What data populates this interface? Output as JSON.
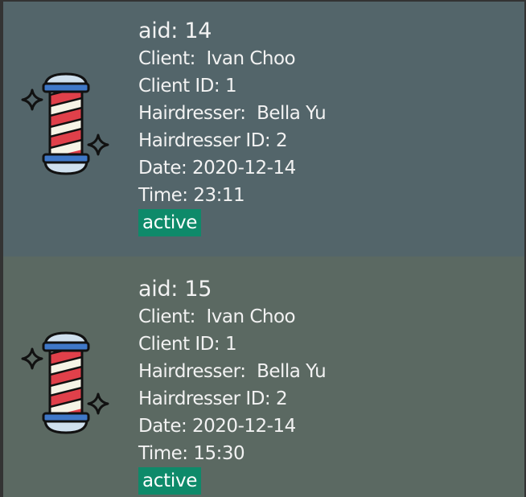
{
  "colors": {
    "card_1_bg": "#53656a",
    "card_2_bg": "#5b6962",
    "badge_bg": "#0e8a6a",
    "pole_red": "#e0404a",
    "pole_blue": "#3f78c8",
    "pole_cream": "#f6f4e6",
    "cap_light": "#cfe0ee"
  },
  "appointments": [
    {
      "icon": "barber-pole-icon",
      "aid": "aid: 14",
      "client": "Client:  Ivan Choo",
      "client_id": "Client ID: 1",
      "hairdresser": "Hairdresser:  Bella Yu",
      "hairdresser_id": "Hairdresser ID: 2",
      "date": "Date: 2020-12-14",
      "time": "Time: 23:11",
      "status": "active"
    },
    {
      "icon": "barber-pole-icon",
      "aid": "aid: 15",
      "client": "Client:  Ivan Choo",
      "client_id": "Client ID: 1",
      "hairdresser": "Hairdresser:  Bella Yu",
      "hairdresser_id": "Hairdresser ID: 2",
      "date": "Date: 2020-12-14",
      "time": "Time: 15:30",
      "status": "active"
    }
  ]
}
